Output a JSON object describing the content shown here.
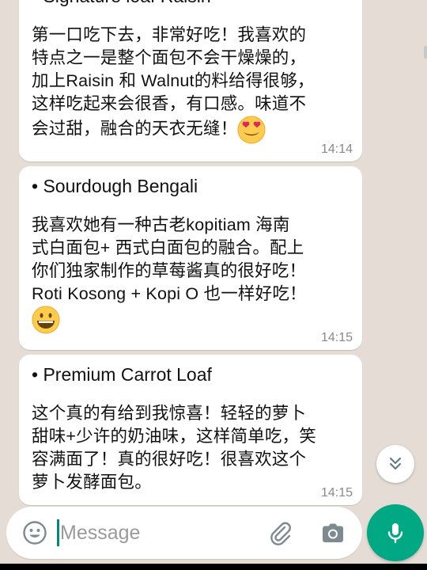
{
  "messages": [
    {
      "title": "• Signature loaf Raisin",
      "body": "第一口吃下去，非常好吃！我喜欢的\n特点之一是整个面包不会干燥燥的，\n加上Raisin 和 Walnut的料给得很够，\n这样吃起来会很香，有口感。味道不\n会过甜，融合的天衣无缝！",
      "emoji": "smiling-face-with-heart-eyes",
      "time": "14:14"
    },
    {
      "title": "• Sourdough Bengali",
      "body": "我喜欢她有一种古老kopitiam 海南\n式白面包+ 西式白面包的融合。配上\n你们独家制作的草莓酱真的很好吃！\nRoti Kosong + Kopi O 也一样好吃！",
      "emoji": "grinning-face",
      "time": "14:15"
    },
    {
      "title": "• Premium Carrot Loaf",
      "body": "这个真的有给到我惊喜！轻轻的萝卜\n甜味+少许的奶油味，这样简单吃，笑\n容满面了！真的很好吃！很喜欢这个\n萝卜发酵面包。",
      "time": "14:15"
    }
  ],
  "composer": {
    "placeholder": "Message",
    "value": ""
  },
  "icons": {
    "emoji_button": "smiley-icon",
    "attach_button": "paperclip-icon",
    "camera_button": "camera-icon",
    "mic_button": "microphone-icon",
    "scroll_down": "double-chevron-down-icon"
  },
  "colors": {
    "chat_background": "#e5ddd5",
    "bubble": "#ffffff",
    "accent": "#00a884",
    "caret": "#00897b",
    "timestamp": "#8a8a8a"
  }
}
